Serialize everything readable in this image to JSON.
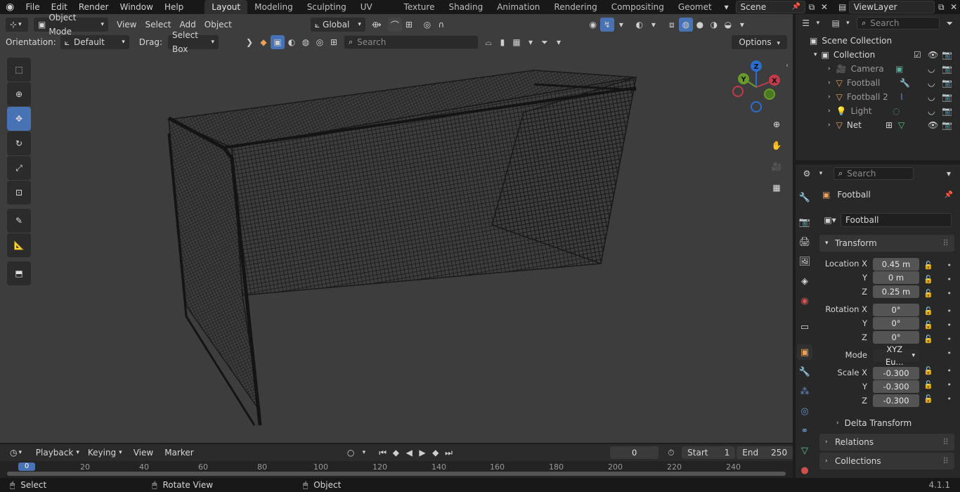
{
  "app": {
    "version": "4.1.1"
  },
  "menu": [
    "File",
    "Edit",
    "Render",
    "Window",
    "Help"
  ],
  "workspaces": [
    "Layout",
    "Modeling",
    "Sculpting",
    "UV Editing",
    "Texture Paint",
    "Shading",
    "Animation",
    "Rendering",
    "Compositing",
    "Geomet"
  ],
  "scene": {
    "name": "Scene"
  },
  "view_layer": {
    "name": "ViewLayer"
  },
  "viewport": {
    "mode": "Object Mode",
    "menus": [
      "View",
      "Select",
      "Add",
      "Object"
    ],
    "transform_orientation": "Global",
    "orientation_label": "Orientation:",
    "orientation_value": "Default",
    "drag_label": "Drag:",
    "drag_value": "Select Box",
    "search_placeholder": "Search",
    "options": "Options",
    "gizmo_axes": [
      "X",
      "Y",
      "Z"
    ]
  },
  "outliner": {
    "search_placeholder": "Search",
    "root": "Scene Collection",
    "collection": "Collection",
    "items": [
      "Camera",
      "Football",
      "Football 2",
      "Light",
      "Net"
    ]
  },
  "properties": {
    "search_placeholder": "Search",
    "object_name": "Football",
    "data_name": "Football",
    "transform_title": "Transform",
    "location_label": "Location X",
    "y_label": "Y",
    "z_label": "Z",
    "location": [
      "0.45 m",
      "0 m",
      "0.25 m"
    ],
    "rotation_label": "Rotation X",
    "rotation": [
      "0°",
      "0°",
      "0°"
    ],
    "mode_label": "Mode",
    "mode_value": "XYZ Eu...",
    "scale_label": "Scale X",
    "scale": [
      "-0.300",
      "-0.300",
      "-0.300"
    ],
    "delta_transform": "Delta Transform",
    "relations": "Relations",
    "collections": "Collections"
  },
  "timeline": {
    "menus": [
      "Playback",
      "Keying",
      "View",
      "Marker"
    ],
    "current_frame": "0",
    "start_label": "Start",
    "start": "1",
    "end_label": "End",
    "end": "250",
    "ticks": [
      "0",
      "20",
      "40",
      "60",
      "80",
      "100",
      "120",
      "140",
      "160",
      "180",
      "200",
      "220",
      "240"
    ]
  },
  "status": [
    "Select",
    "Rotate View",
    "Object"
  ],
  "colors": {
    "accent": "#4772b3",
    "orange": "#e8a05a",
    "active_tab": "#303030"
  }
}
